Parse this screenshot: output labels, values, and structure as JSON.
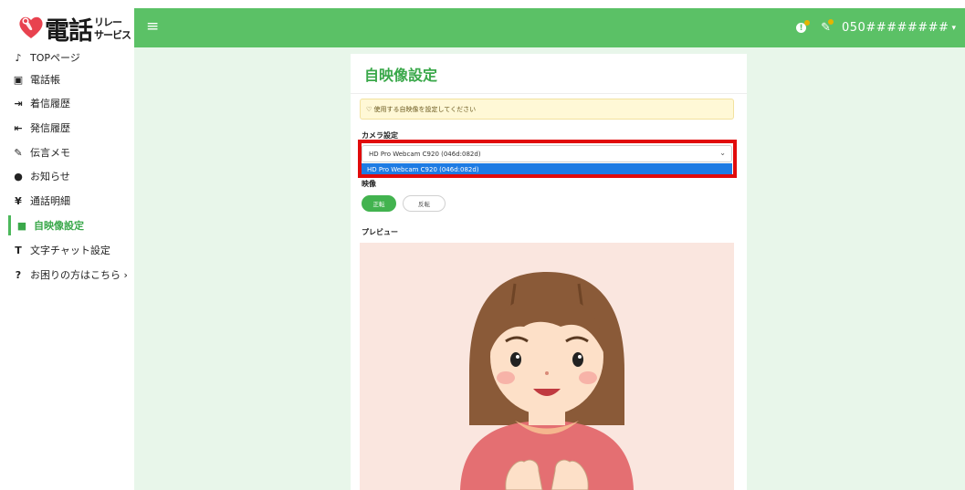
{
  "header": {
    "logo_main": "電話",
    "logo_sub_top": "リレー",
    "logo_sub_bottom": "サービス",
    "menu_icon": "≡",
    "phone_number": "050########"
  },
  "sidebar": {
    "items": [
      {
        "icon": "♪",
        "label": "TOPページ"
      },
      {
        "icon": "▣",
        "label": "電話帳"
      },
      {
        "icon": "⇥",
        "label": "着信履歴"
      },
      {
        "icon": "⇤",
        "label": "発信履歴"
      },
      {
        "icon": "✎",
        "label": "伝言メモ"
      },
      {
        "icon": "●",
        "label": "お知らせ"
      },
      {
        "icon": "¥",
        "label": "通話明細"
      },
      {
        "icon": "■",
        "label": "自映像設定"
      },
      {
        "icon": "T",
        "label": "文字チャット設定"
      },
      {
        "icon": "?",
        "label": "お困りの方はこちら ›"
      }
    ]
  },
  "main": {
    "title": "自映像設定",
    "alert_text": "♡ 使用する自映像を設定してください",
    "camera_label": "カメラ設定",
    "camera_selected": "HD Pro Webcam C920 (046d:082d)",
    "camera_option": "HD Pro Webcam C920 (046d:082d)",
    "image_label": "映像",
    "btn_normal": "正転",
    "btn_reverse": "反転",
    "preview_label": "プレビュー"
  },
  "colors": {
    "brand_green": "#5bc166",
    "active_green": "#3aa84a",
    "main_bg": "#e8f6ea",
    "highlight_red": "#e10b0b",
    "select_blue": "#1e7be3"
  }
}
